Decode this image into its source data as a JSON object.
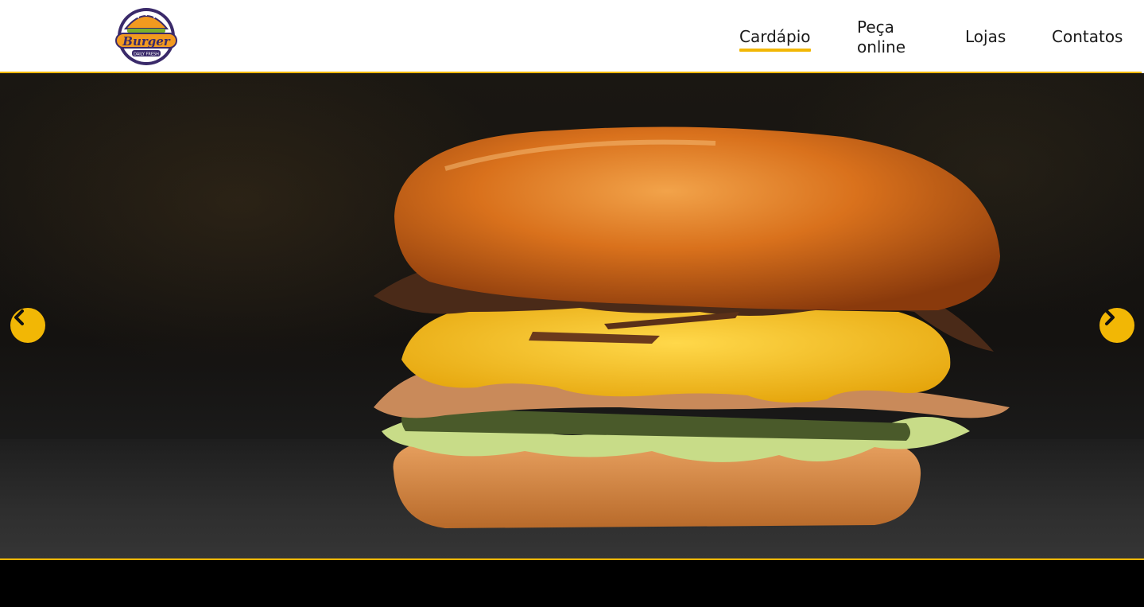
{
  "brand": {
    "logo_text": "Burger",
    "logo_subtext": "DAILY FRESH"
  },
  "nav": {
    "items": [
      {
        "label": "Cardápio",
        "active": true
      },
      {
        "label": "Peça online",
        "active": false
      },
      {
        "label": "Lojas",
        "active": false
      },
      {
        "label": "Contatos",
        "active": false
      }
    ]
  },
  "carousel": {
    "prev_icon": "chevron-left-icon",
    "next_icon": "chevron-right-icon"
  },
  "colors": {
    "accent": "#f2b705",
    "header_bg": "#ffffff",
    "footer_bg": "#000000"
  }
}
